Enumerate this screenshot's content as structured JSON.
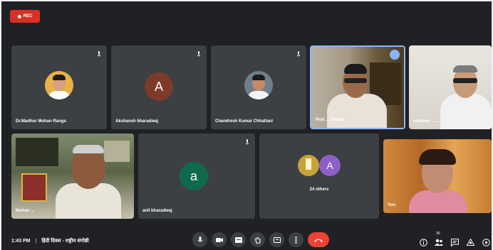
{
  "recording": {
    "label": "REC",
    "color": "#d93025"
  },
  "participants": {
    "madhur": {
      "name": "Dr.Madhur Mohan Ranga"
    },
    "akshansh": {
      "name": "Akshansh bharadwaj",
      "initial": "A",
      "color": "#7d3a28"
    },
    "chandresh": {
      "name": "Chandresh Kumar Chhatlani"
    },
    "presenter": {
      "name": "Prof. ... Gupta"
    },
    "tile5": {
      "name": "pradeep ... ..."
    },
    "tile6": {
      "name": "Mohan ..."
    },
    "anil": {
      "name": "anil bharadwaj",
      "initial": "a",
      "color": "#0f6a4d"
    },
    "others": {
      "label": "24 others",
      "initial": "A",
      "color": "#8e5fc7"
    },
    "tile9": {
      "name": "You"
    }
  },
  "bottom_bar": {
    "time": "1:43 PM",
    "separator": "|",
    "meeting_title": "हिंदी दिवस - राष्ट्रीय संगोष्ठी",
    "icons": [
      "mic-icon",
      "camera-icon",
      "captions-icon",
      "raise-hand-icon",
      "present-icon",
      "more-icon",
      "end-call-icon"
    ],
    "right_icons": [
      "info-icon",
      "people-icon",
      "chat-icon",
      "activities-icon",
      "host-controls-icon"
    ],
    "people_count": "35"
  },
  "colors": {
    "tile_bg": "#3c4043",
    "meet_bg": "#202124",
    "end_call": "#ea4335",
    "active_border": "#8ab4f8"
  }
}
